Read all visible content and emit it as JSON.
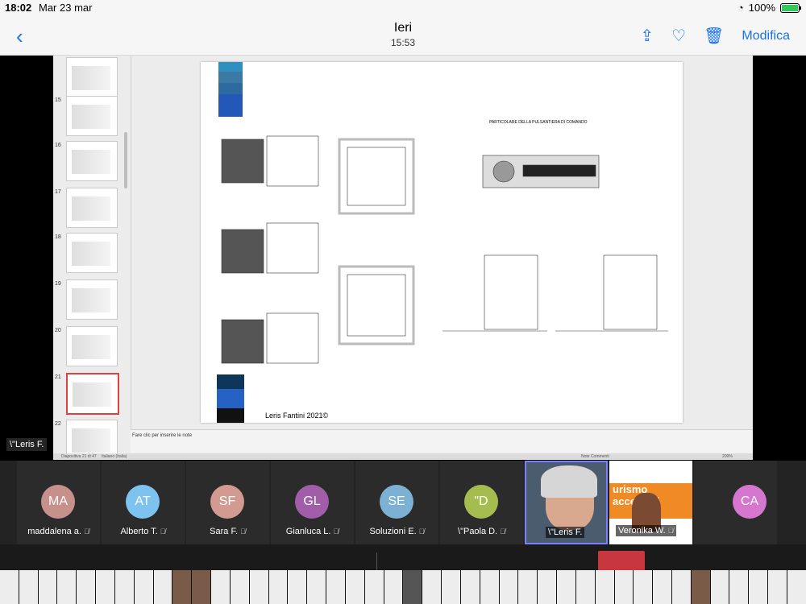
{
  "status": {
    "time": "18:02",
    "date": "Mar 23 mar",
    "battery": "100%"
  },
  "nav": {
    "back_icon": "chevron-left-icon",
    "title": "Ieri",
    "subtitle": "15:53",
    "share_icon": "share-icon",
    "favorite_icon": "heart-icon",
    "delete_icon": "trash-icon",
    "edit_label": "Modifica"
  },
  "presentation": {
    "slides": [
      "15",
      "16",
      "17",
      "18",
      "19",
      "20",
      "21",
      "22"
    ],
    "selected_slide": "21",
    "notes_placeholder": "Fare clic per inserire le note",
    "status_left": "Diapositiva 21 di 47",
    "status_lang": "Italiano (Italia)",
    "status_right": "Note   Commenti",
    "zoom": "209%",
    "slide_content": {
      "heading_right": "PARTICOLARE DELLA PULSANTIERA DI COMANDO",
      "footer": "Leris Fantini 2021©"
    }
  },
  "sidebar_label": "\\\"Leris F.",
  "participants": [
    {
      "initials": "MA",
      "name": "maddalena a.",
      "color": "#c7918b"
    },
    {
      "initials": "AT",
      "name": "Alberto T.",
      "color": "#7ec3ef"
    },
    {
      "initials": "SF",
      "name": "Sara F.",
      "color": "#d39a92"
    },
    {
      "initials": "GL",
      "name": "Gianluca L.",
      "color": "#a05ea8"
    },
    {
      "initials": "SE",
      "name": "Soluzioni E.",
      "color": "#7db1d4"
    },
    {
      "initials": "\"D",
      "name": "\\\"Paola D.",
      "color": "#a5bd4f"
    },
    {
      "initials": "",
      "name": "\\\"Leris F.",
      "color": ""
    },
    {
      "initials": "",
      "name": "Veronika W.",
      "color": ""
    },
    {
      "initials": "CA",
      "name": "",
      "color": "#d577cf"
    }
  ],
  "veronika_banner": "urismo accessibi"
}
